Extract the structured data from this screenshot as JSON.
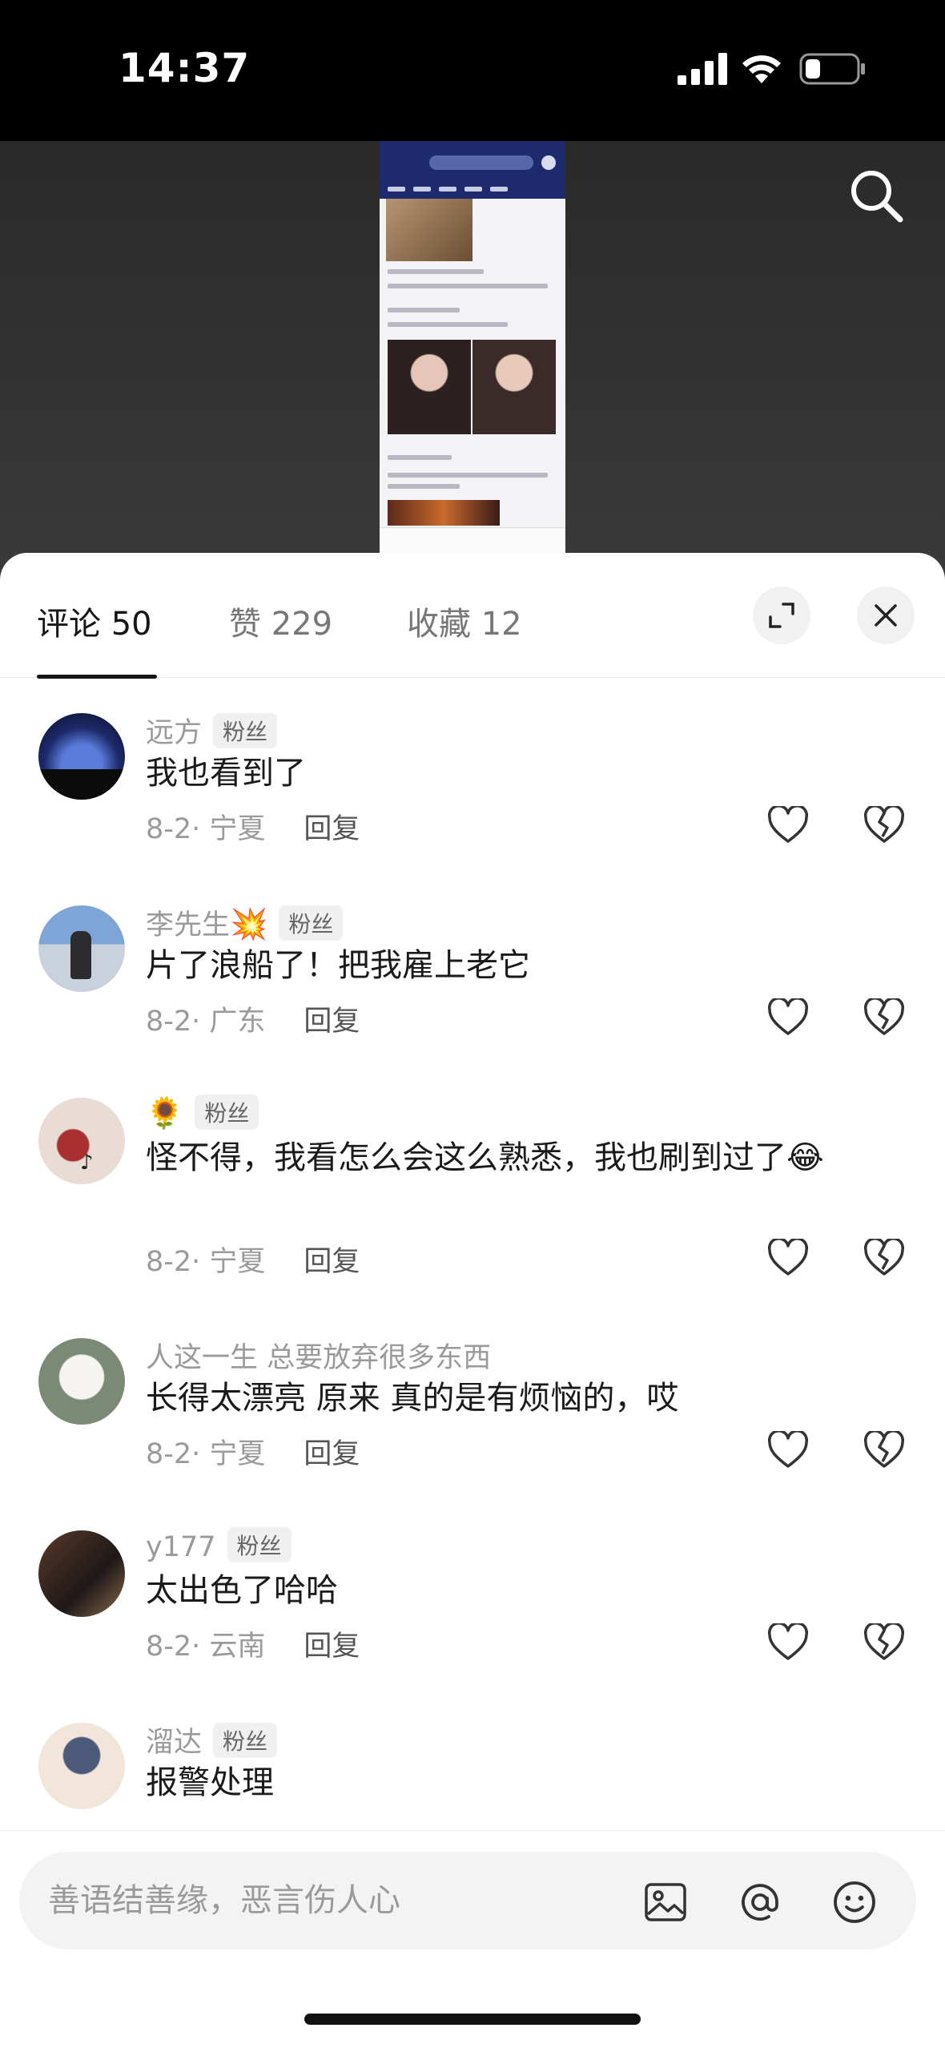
{
  "status_bar": {
    "time": "14:37"
  },
  "tabs": [
    {
      "label": "评论 50"
    },
    {
      "label": "赞 229"
    },
    {
      "label": "收藏 12"
    }
  ],
  "icons": {
    "expand": "expand-icon",
    "close": "close-icon",
    "search": "search-icon",
    "like": "heart-outline-icon",
    "dislike": "broken-heart-icon",
    "image": "image-icon",
    "mention": "at-icon",
    "emoji": "smile-icon"
  },
  "comments": [
    {
      "name": "远方",
      "badge": "粉丝",
      "emoji": "",
      "text": "我也看到了",
      "meta": "8-2· 宁夏",
      "reply": "回复"
    },
    {
      "name": "李先生",
      "badge": "粉丝",
      "emoji": "💥",
      "text": "片了浪船了！把我雇上老它",
      "meta": "8-2· 广东",
      "reply": "回复"
    },
    {
      "name": "",
      "badge": "粉丝",
      "emoji": "🌻",
      "text": "怪不得，我看怎么会这么熟悉，我也刷到过了😂",
      "meta": "8-2· 宁夏",
      "reply": "回复"
    },
    {
      "name": "人这一生 总要放弃很多东西",
      "badge": "",
      "emoji": "",
      "text": "长得太漂亮 原来 真的是有烦恼的，哎",
      "meta": "8-2· 宁夏",
      "reply": "回复"
    },
    {
      "name": "y177",
      "badge": "粉丝",
      "emoji": "",
      "text": "太出色了哈哈",
      "meta": "8-2· 云南",
      "reply": "回复"
    },
    {
      "name": "溜达",
      "badge": "粉丝",
      "emoji": "",
      "text": "报警处理",
      "meta": "",
      "reply": ""
    }
  ],
  "input": {
    "placeholder": "善语结善缘，恶言伤人心"
  },
  "colors": {
    "accent_text": "#161616",
    "muted": "#9a9a9a",
    "sheet": "#ffffff"
  }
}
